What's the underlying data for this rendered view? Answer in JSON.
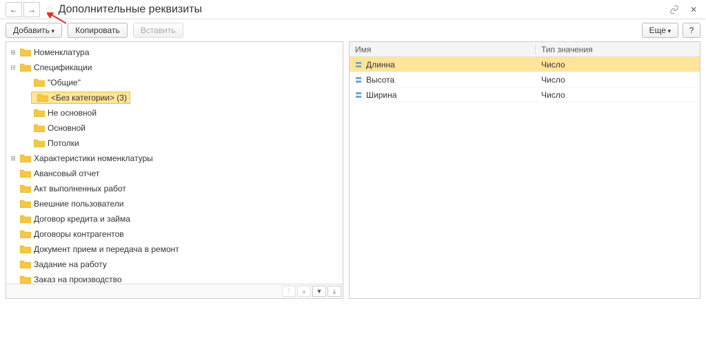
{
  "header": {
    "title": "Дополнительные реквизиты"
  },
  "toolbar": {
    "add_label": "Добавить",
    "copy_label": "Копировать",
    "paste_label": "Вставить",
    "more_label": "Еще"
  },
  "tree": [
    {
      "label": "Номенклатура",
      "level": 0,
      "toggle": "+",
      "selected": false
    },
    {
      "label": "Спецификации",
      "level": 0,
      "toggle": "-",
      "selected": false
    },
    {
      "label": "\"Общие\"",
      "level": 1,
      "toggle": "",
      "selected": false
    },
    {
      "label": "<Без категории> (3)",
      "level": 1,
      "toggle": "",
      "selected": true
    },
    {
      "label": "Не основной",
      "level": 1,
      "toggle": "",
      "selected": false
    },
    {
      "label": "Основной",
      "level": 1,
      "toggle": "",
      "selected": false
    },
    {
      "label": "Потолки",
      "level": 1,
      "toggle": "",
      "selected": false
    },
    {
      "label": "Характеристики номенклатуры",
      "level": 0,
      "toggle": "+",
      "selected": false
    },
    {
      "label": "Авансовый отчет",
      "level": 0,
      "toggle": "",
      "selected": false
    },
    {
      "label": "Акт выполненных работ",
      "level": 0,
      "toggle": "",
      "selected": false
    },
    {
      "label": "Внешние пользователи",
      "level": 0,
      "toggle": "",
      "selected": false
    },
    {
      "label": "Договор кредита и займа",
      "level": 0,
      "toggle": "",
      "selected": false
    },
    {
      "label": "Договоры контрагентов",
      "level": 0,
      "toggle": "",
      "selected": false
    },
    {
      "label": "Документ прием и передача в ремонт",
      "level": 0,
      "toggle": "",
      "selected": false
    },
    {
      "label": "Задание на работу",
      "level": 0,
      "toggle": "",
      "selected": false
    },
    {
      "label": "Заказ на производство",
      "level": 0,
      "toggle": "",
      "selected": false
    }
  ],
  "table": {
    "header_name": "Имя",
    "header_type": "Тип значения",
    "rows": [
      {
        "name": "Длинна",
        "type": "Число",
        "selected": true
      },
      {
        "name": "Высота",
        "type": "Число",
        "selected": false
      },
      {
        "name": "Ширина",
        "type": "Число",
        "selected": false
      }
    ]
  }
}
